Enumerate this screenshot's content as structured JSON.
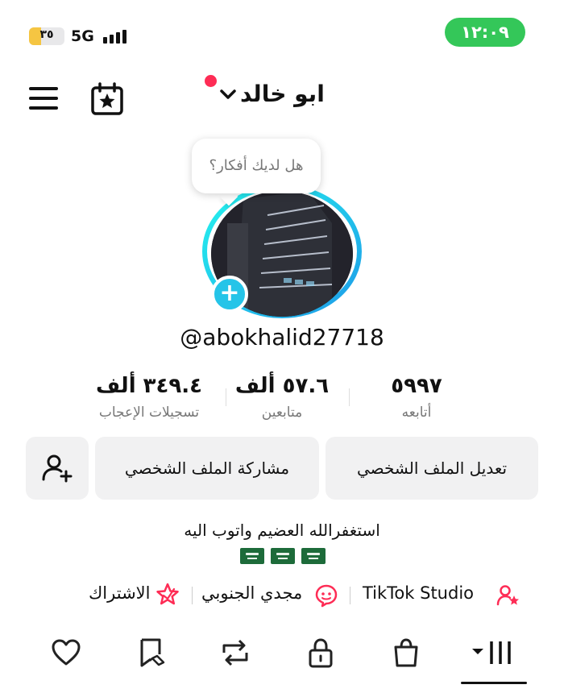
{
  "status_bar": {
    "battery_text": "٣٥",
    "battery_level": 0.35,
    "network": "5G",
    "time": "١٢:٠٩"
  },
  "header": {
    "title": "ابو خالد",
    "menu_icon": "hamburger-menu-icon",
    "calendar_icon": "calendar-star-icon",
    "dropdown_icon": "chevron-down-icon",
    "notification_dot_color": "#fe2c55"
  },
  "profile": {
    "idea_bubble": "هل لديك أفكار؟",
    "username": "@abokhalid27718",
    "add_icon": "plus-icon"
  },
  "stats": [
    {
      "value": "٥٩٩٧",
      "label": "أتابعه"
    },
    {
      "value": "٥٧.٦ ألف",
      "label": "متابعين"
    },
    {
      "value": "٣٤٩.٤ ألف",
      "label": "تسجيلات الإعجاب"
    }
  ],
  "actions": {
    "edit_profile": "تعديل الملف الشخصي",
    "share_profile": "مشاركة الملف الشخصي",
    "add_friend_icon": "add-user-icon"
  },
  "bio": {
    "text": "استغفرالله العضيم واتوب اليه",
    "flags": [
      "saudi-flag-icon",
      "saudi-flag-icon",
      "saudi-flag-icon"
    ]
  },
  "links": {
    "studio": "TikTok Studio",
    "mention": "مجدي الجنوبي",
    "subscribe": "الاشتراك"
  },
  "tabs": [
    {
      "name": "videos-grid-icon",
      "active": true
    },
    {
      "name": "shop-bag-icon"
    },
    {
      "name": "lock-icon"
    },
    {
      "name": "repost-icon"
    },
    {
      "name": "favorites-icon"
    },
    {
      "name": "liked-heart-icon"
    }
  ],
  "colors": {
    "accent": "#fe2c55",
    "ring": "#25c4e8",
    "time_pill": "#34c759",
    "button_bg": "#f1f1f2"
  }
}
